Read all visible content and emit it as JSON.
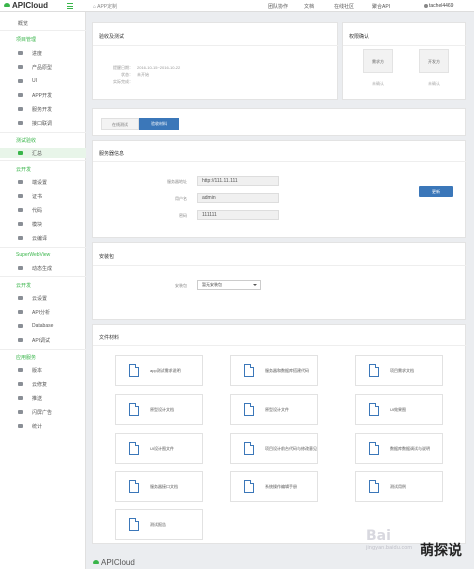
{
  "topbar": {
    "logo": "APICloud",
    "breadcrumb": "APP定制",
    "nav": [
      "团队协作",
      "文档",
      "在线社区",
      "聚合API"
    ],
    "user": "tachel4469"
  },
  "sidebar": {
    "overview": "概览",
    "group1": "项目管理",
    "group1_items": [
      "进度",
      "产品原型",
      "UI",
      "APP开发",
      "服务开发",
      "接口联调"
    ],
    "group2": "测试验收",
    "group2_items": [
      "汇总"
    ],
    "group3": "云开发",
    "group3_items": [
      "端设置",
      "证书",
      "代码",
      "模块",
      "云编译"
    ],
    "group4": "SuperWebView",
    "group4_items": [
      "动态生成"
    ],
    "group5": "云开发",
    "group5_items": [
      "云设置",
      "API分析",
      "Database",
      "API调试"
    ],
    "group6": "应用服务",
    "group6_items": [
      "版本",
      "云修复",
      "推送",
      "闪屏广告",
      "统计"
    ]
  },
  "acceptance": {
    "title": "验收及测试",
    "rows": [
      {
        "k": "提醒日期：",
        "v": "2016-10-15~2016-10-22"
      },
      {
        "k": "状态：",
        "v": "未开始"
      },
      {
        "k": "实际完成：",
        "v": ""
      }
    ]
  },
  "permission": {
    "title": "权限确认",
    "boxes": [
      {
        "label": "需求方",
        "status": "未确认"
      },
      {
        "label": "开发方",
        "status": "未确认"
      }
    ]
  },
  "tabs": [
    "在线测试",
    "验收材料"
  ],
  "server": {
    "title": "服务器信息",
    "fields": [
      {
        "label": "服务器地址",
        "value": "http://111.11.111"
      },
      {
        "label": "用户名",
        "value": "admin"
      },
      {
        "label": "密码",
        "value": "111111"
      }
    ],
    "button": "更新"
  },
  "install": {
    "title": "安装包",
    "label": "安装包",
    "select": "暂无安装包"
  },
  "docs": {
    "title": "文件材料",
    "items": [
      "app测试需求说明",
      "服务器和数据库搭建代码",
      "项目需求文档",
      "原型设计文档",
      "原型设计文件",
      "UI效果图",
      "UI设计图文件",
      "项目设计前台代码与修改意见",
      "数据库数据调试与说明",
      "服务器接口文档",
      "系统操作编辑手册",
      "测试用例",
      "测试报告"
    ]
  },
  "footer": {
    "logo": "APICloud"
  },
  "watermark": {
    "baidu": "Bai",
    "site": "jingyan.baidu.com",
    "brand": "萌探说"
  }
}
